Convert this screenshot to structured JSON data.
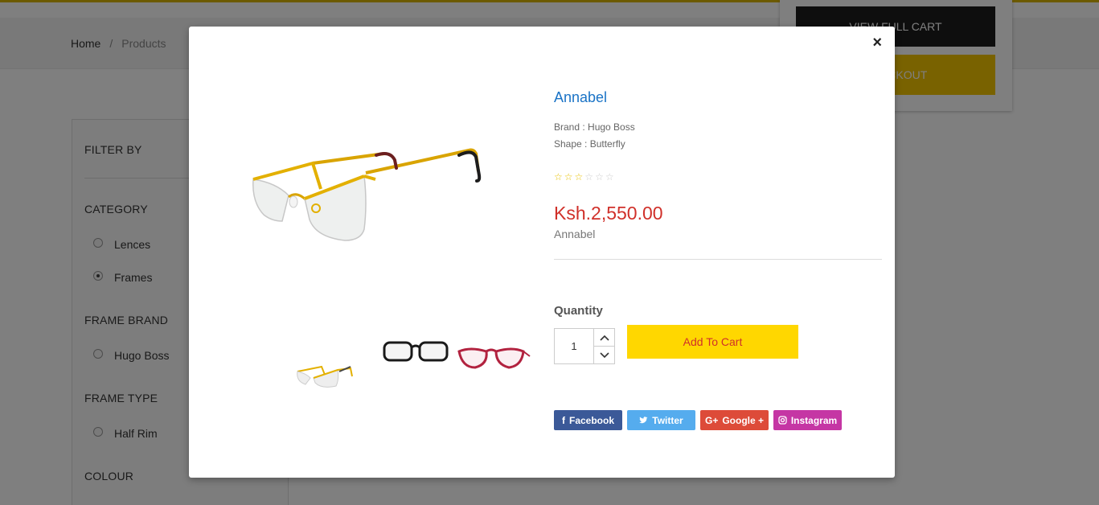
{
  "breadcrumb": {
    "home": "Home",
    "separator": "/",
    "current": "Products"
  },
  "sidebar": {
    "filter_by": "FILTER BY",
    "category": {
      "title": "CATEGORY",
      "options": [
        "Lences",
        "Frames"
      ],
      "selected": "Frames"
    },
    "frame_brand": {
      "title": "FRAME BRAND",
      "options": [
        "Hugo Boss"
      ]
    },
    "frame_type": {
      "title": "FRAME TYPE",
      "options": [
        "Half Rim"
      ]
    },
    "colour": {
      "title": "COLOUR"
    }
  },
  "cart_dropdown": {
    "view_full_cart": "VIEW FULL CART",
    "checkout": "CHECKOUT"
  },
  "modal": {
    "close_icon": "×",
    "title": "Annabel",
    "brand_label": "Brand : ",
    "brand_value": "Hugo Boss",
    "shape_label": "Shape : ",
    "shape_value": "Butterfly",
    "rating": 3,
    "rating_max": 6,
    "price": "Ksh.2,550.00",
    "price_sub": "Annabel",
    "quantity_label": "Quantity",
    "quantity_value": "1",
    "add_to_cart": "Add To Cart",
    "thumbnails": [
      "gold-half-rim-glasses-thumbnail",
      "black-frame-glasses-thumbnail",
      "red-cat-eye-glasses-thumbnail"
    ],
    "social": [
      {
        "label": "Facebook",
        "icon": "f",
        "color": "#3b5998"
      },
      {
        "label": "Twitter",
        "icon": "twitter-bird",
        "color": "#55acee"
      },
      {
        "label": "Google +",
        "icon": "G+",
        "color": "#dd4b39"
      },
      {
        "label": "Instagram",
        "icon": "instagram-camera",
        "color": "#c536a4"
      }
    ]
  },
  "colors": {
    "accent_yellow": "#ffd700",
    "price_red": "#d0302a",
    "title_blue": "#1a73c6"
  }
}
